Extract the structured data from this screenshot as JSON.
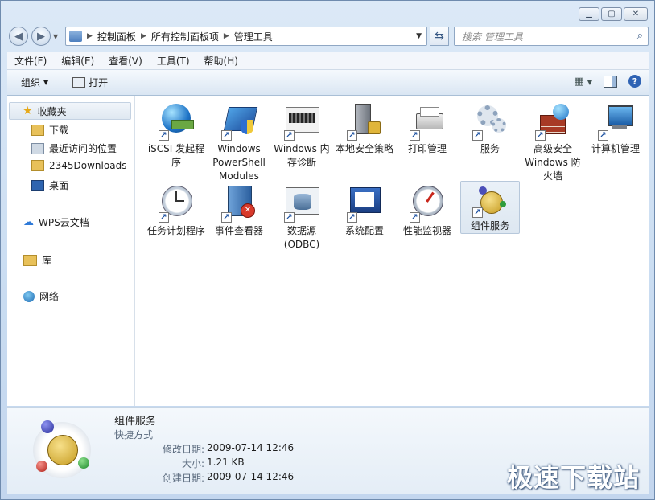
{
  "address": {
    "crumbs": [
      "控制面板",
      "所有控制面板项",
      "管理工具"
    ]
  },
  "search": {
    "placeholder": "搜索 管理工具"
  },
  "menu": [
    "文件(F)",
    "编辑(E)",
    "查看(V)",
    "工具(T)",
    "帮助(H)"
  ],
  "toolbar": {
    "organize": "组织",
    "open": "打开"
  },
  "nav": {
    "favorites": "收藏夹",
    "items": [
      "下载",
      "最近访问的位置",
      "2345Downloads",
      "桌面"
    ],
    "wps": "WPS云文档",
    "library": "库",
    "network": "网络"
  },
  "tiles": [
    {
      "label": "iSCSI 发起程序",
      "icon": "iscsi-icon"
    },
    {
      "label": "Windows PowerShell Modules",
      "icon": "powershell-icon"
    },
    {
      "label": "Windows 内存诊断",
      "icon": "memory-diagnostics-icon"
    },
    {
      "label": "本地安全策略",
      "icon": "local-security-policy-icon"
    },
    {
      "label": "打印管理",
      "icon": "print-management-icon"
    },
    {
      "label": "服务",
      "icon": "services-icon"
    },
    {
      "label": "高级安全 Windows 防火墙",
      "icon": "firewall-icon"
    },
    {
      "label": "计算机管理",
      "icon": "computer-management-icon"
    },
    {
      "label": "任务计划程序",
      "icon": "task-scheduler-icon"
    },
    {
      "label": "事件查看器",
      "icon": "event-viewer-icon"
    },
    {
      "label": "数据源 (ODBC)",
      "icon": "odbc-icon"
    },
    {
      "label": "系统配置",
      "icon": "system-config-icon"
    },
    {
      "label": "性能监视器",
      "icon": "performance-monitor-icon"
    },
    {
      "label": "组件服务",
      "icon": "component-services-icon"
    }
  ],
  "details": {
    "name": "组件服务",
    "type": "快捷方式",
    "modified_label": "修改日期:",
    "modified": "2009-07-14 12:46",
    "size_label": "大小:",
    "size": "1.21 KB",
    "created_label": "创建日期:",
    "created": "2009-07-14 12:46"
  },
  "watermark": "极速下载站"
}
